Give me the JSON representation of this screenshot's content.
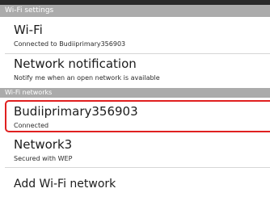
{
  "wifi_settings_header": "Wi-Fi settings",
  "wifi": {
    "title": "Wi-Fi",
    "summary": "Connected to Budiiprimary356903"
  },
  "network_notification": {
    "title": "Network notification",
    "summary": "Notify me when an open network is available"
  },
  "wifi_networks_header": "Wi-Fi networks",
  "networks": [
    {
      "name": "Budiiprimary356903",
      "status": "Connected"
    },
    {
      "name": "Network3",
      "status": "Secured with WEP"
    }
  ],
  "add_network_label": "Add Wi-Fi network",
  "colors": {
    "section_header_bg": "#ababab",
    "selection_border": "#e02020",
    "divider": "#d6d6d6"
  }
}
